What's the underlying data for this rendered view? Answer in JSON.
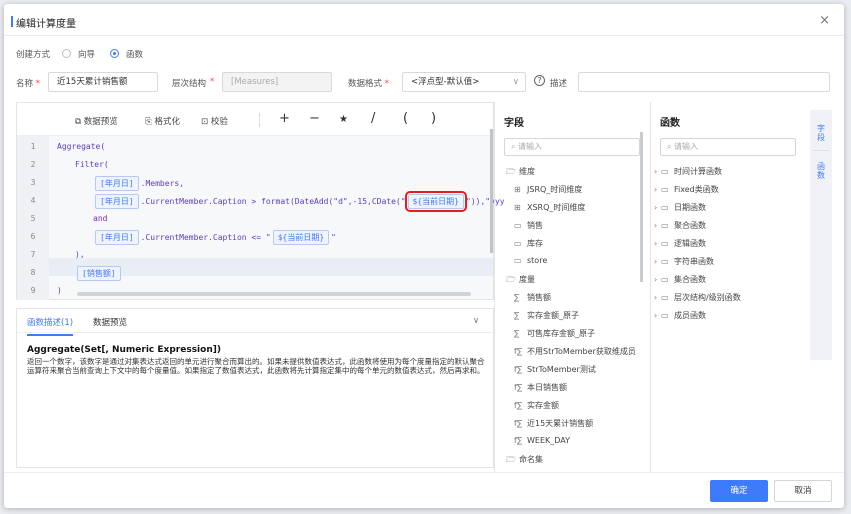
{
  "dialog": {
    "title": "编辑计算度量",
    "close": "×"
  },
  "create": {
    "label": "创建方式",
    "opt1": "向导",
    "opt2": "函数"
  },
  "form": {
    "name_label": "名称",
    "name_value": "近15天累计销售额",
    "hier_label": "层次结构",
    "hier_value": "[Measures]",
    "format_label": "数据格式",
    "format_value": "<浮点型-默认值>",
    "help_icon": "?",
    "desc_label": "描述",
    "req": "*"
  },
  "toolbar": {
    "preview": "数据预览",
    "format": "格式化",
    "check": "校验",
    "plus": "+",
    "minus": "−",
    "star": "★",
    "slash": "/",
    "lpar": "(",
    "rpar": ")"
  },
  "code": {
    "n": [
      "1",
      "2",
      "3",
      "4",
      "5",
      "6",
      "7",
      "8",
      "9"
    ],
    "l1": "Aggregate(",
    "l2": "Filter(",
    "r3": "[年月日]",
    "l3": ".Members,",
    "r4": "[年月日]",
    "l4a": ".CurrentMember.Caption > format(DateAdd(\"d\",-15,CDate(\"",
    "r4b": "${当前日期}",
    "l4c": "\")),\"yyy",
    "l5": "and",
    "r6": "[年月日]",
    "l6a": ".CurrentMember.Caption <= \"",
    "r6b": "${当前日期}",
    "l6c": "\"",
    "l7": "),",
    "r8": "[销售额]",
    "l9": ")"
  },
  "desc": {
    "tab1": "函数描述(1)",
    "tab2": "数据预览",
    "chevron": "∨",
    "heading": "Aggregate(Set[, Numeric Expression])",
    "body": "返回一个数字，该数字是通过对集表达式返回的单元进行聚合而算出的。如果未提供数值表达式，此函数将使用为每个度量指定的默认聚合运算符来聚合当前查询上下文中的每个度量值。如果指定了数值表达式，此函数将先计算指定集中的每个单元的数值表达式，然后再求和。"
  },
  "fields": {
    "title": "字段",
    "search": "请输入",
    "items": [
      "维度",
      "JSRQ_时间维度",
      "XSRQ_时间维度",
      "销售",
      "库存",
      "store",
      "度量",
      "销售额",
      "实存金额_原子",
      "可售库存金额_原子",
      "不用StrToMember获取维成员",
      "StrToMember测试",
      "本日销售额",
      "实存金额",
      "近15天累计销售额",
      "WEEK_DAY",
      "命名集"
    ]
  },
  "funcs": {
    "title": "函数",
    "search": "请输入",
    "items": [
      "时间计算函数",
      "Fixed类函数",
      "日期函数",
      "聚合函数",
      "逻辑函数",
      "字符串函数",
      "集合函数",
      "层次结构/级别函数",
      "成员函数"
    ]
  },
  "side": {
    "tab1": "字段",
    "tab2": "函数"
  },
  "buttons": {
    "ok": "确定",
    "cancel": "取消"
  }
}
